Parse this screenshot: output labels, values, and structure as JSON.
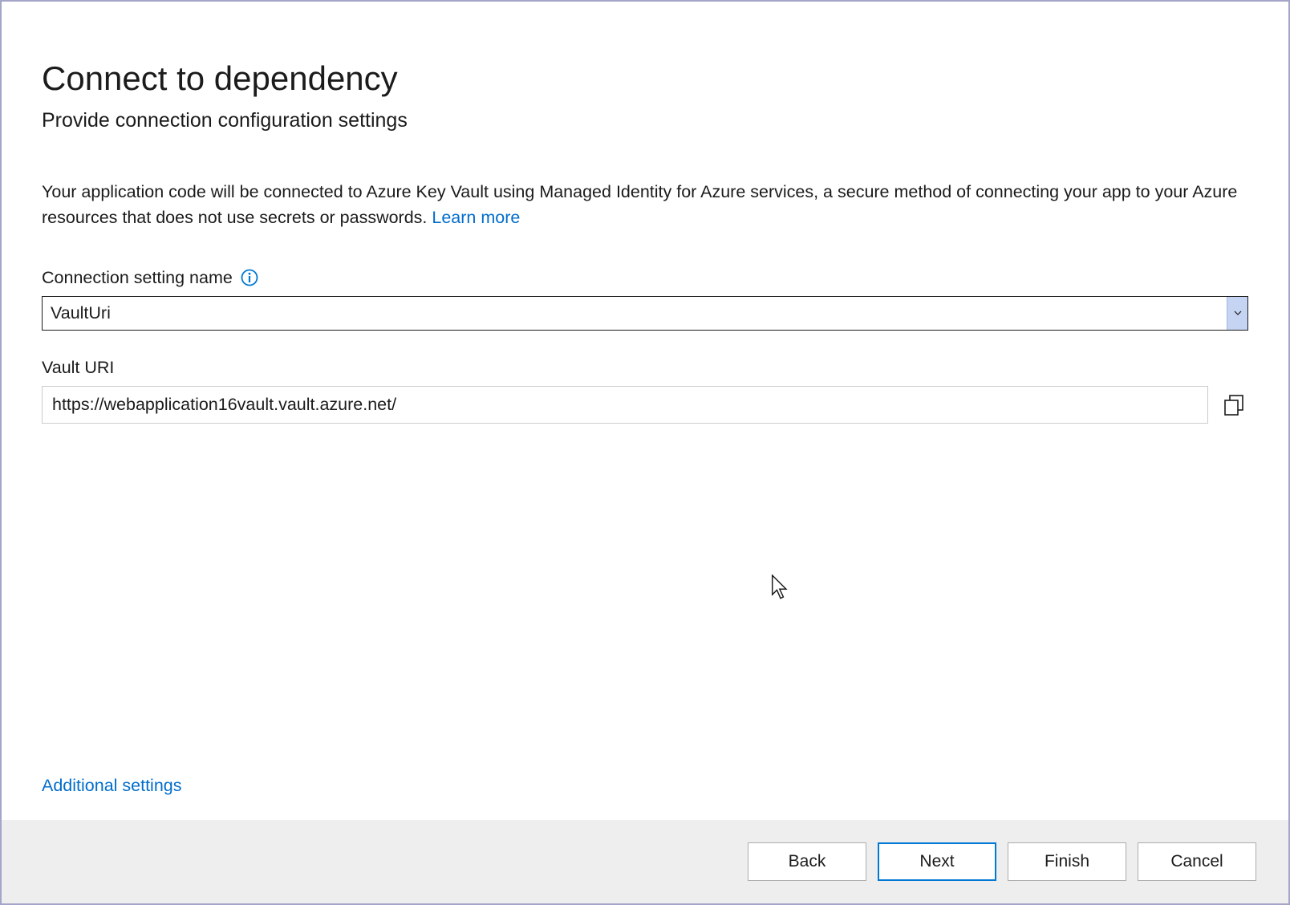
{
  "dialog": {
    "title": "Connect to dependency",
    "subtitle": "Provide connection configuration settings",
    "description_text": "Your application code will be connected to Azure Key Vault using Managed Identity for Azure services, a secure method of connecting your app to your Azure resources that does not use secrets or passwords.  ",
    "learn_more": "Learn more"
  },
  "fields": {
    "connection_setting": {
      "label": "Connection setting name",
      "value": "VaultUri"
    },
    "vault_uri": {
      "label": "Vault URI",
      "value": "https://webapplication16vault.vault.azure.net/"
    }
  },
  "links": {
    "additional_settings": "Additional settings"
  },
  "buttons": {
    "back": "Back",
    "next": "Next",
    "finish": "Finish",
    "cancel": "Cancel"
  }
}
